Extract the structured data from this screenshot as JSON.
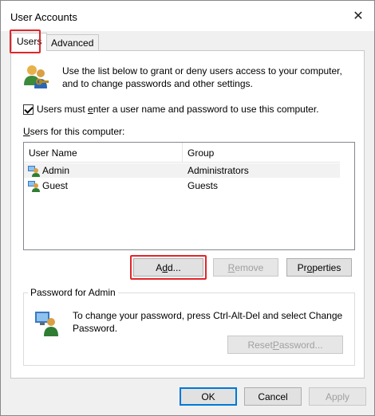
{
  "window": {
    "title": "User Accounts",
    "close_glyph": "✕"
  },
  "tabs": [
    {
      "label": "Users",
      "active": true
    },
    {
      "label": "Advanced",
      "active": false
    }
  ],
  "intro": {
    "text_line1": "Use the list below to grant or deny users access to your computer,",
    "text_line2": "and to change passwords and other settings."
  },
  "checkbox": {
    "label_pre": "Users must ",
    "label_ul": "e",
    "label_post": "nter a user name and password to use this computer.",
    "checked": true
  },
  "users_list": {
    "label_ul": "U",
    "label_rest": "sers for this computer:",
    "columns": [
      "User Name",
      "Group"
    ],
    "rows": [
      {
        "name": "Admin",
        "group": "Administrators",
        "selected": true
      },
      {
        "name": "Guest",
        "group": "Guests",
        "selected": false
      }
    ]
  },
  "buttons": {
    "add_pre": "A",
    "add_ul": "d",
    "add_post": "d...",
    "remove_ul": "R",
    "remove_post": "emove",
    "properties_pre": "Pr",
    "properties_ul": "o",
    "properties_post": "perties",
    "ok": "OK",
    "cancel": "Cancel",
    "apply": "Apply"
  },
  "password_group": {
    "title": "Password for Admin",
    "text_line1": "To change your password, press Ctrl-Alt-Del and select Change",
    "text_line2": "Password.",
    "reset_pre": "Reset ",
    "reset_ul": "P",
    "reset_post": "assword..."
  },
  "colors": {
    "highlight": "#e0262b",
    "default_border": "#0078d7"
  }
}
